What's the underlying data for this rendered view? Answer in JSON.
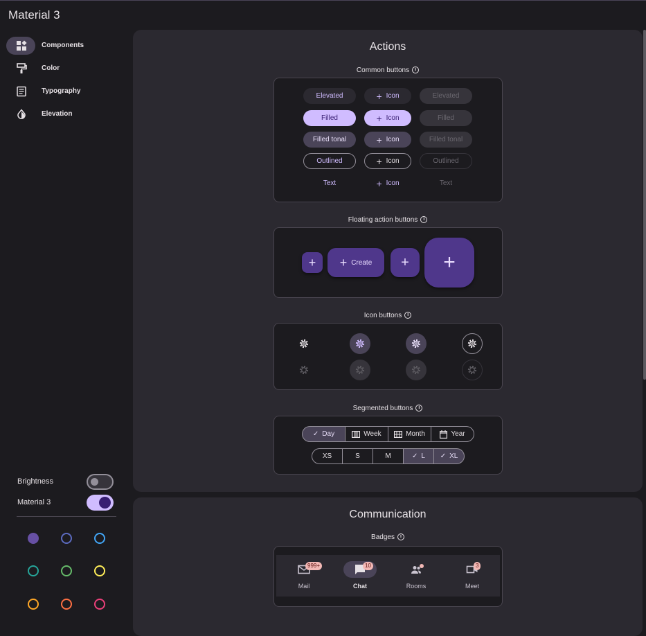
{
  "app": {
    "title": "Material 3"
  },
  "nav": {
    "items": [
      {
        "label": "Components",
        "icon": "widgets-icon",
        "active": true
      },
      {
        "label": "Color",
        "icon": "format-paint-icon"
      },
      {
        "label": "Typography",
        "icon": "article-icon"
      },
      {
        "label": "Elevation",
        "icon": "opacity-icon"
      }
    ]
  },
  "settings": {
    "brightness_label": "Brightness",
    "brightness_on": false,
    "material3_label": "Material 3",
    "material3_on": true,
    "color_choices": [
      "#6750a4",
      "#5c6bc0",
      "#42a5f5",
      "#26a69a",
      "#66bb6a",
      "#ffee58",
      "#ffa726",
      "#ff7043",
      "#ec407a"
    ]
  },
  "actions": {
    "title": "Actions",
    "common": {
      "title": "Common buttons",
      "rows": [
        {
          "enabled": "Elevated",
          "icon": "Icon",
          "disabled": "Elevated"
        },
        {
          "enabled": "Filled",
          "icon": "Icon",
          "disabled": "Filled"
        },
        {
          "enabled": "Filled tonal",
          "icon": "Icon",
          "disabled": "Filled tonal"
        },
        {
          "enabled": "Outlined",
          "icon": "Icon",
          "disabled": "Outlined"
        },
        {
          "enabled": "Text",
          "icon": "Icon",
          "disabled": "Text"
        }
      ]
    },
    "fab": {
      "title": "Floating action buttons",
      "extended_label": "Create"
    },
    "icon_buttons": {
      "title": "Icon buttons"
    },
    "segmented": {
      "title": "Segmented buttons",
      "row1": [
        "Day",
        "Week",
        "Month",
        "Year"
      ],
      "row2": [
        "XS",
        "S",
        "M",
        "L",
        "XL"
      ]
    }
  },
  "communication": {
    "title": "Communication",
    "badges": {
      "title": "Badges",
      "items": [
        {
          "label": "Mail",
          "badge": "999+"
        },
        {
          "label": "Chat",
          "badge": "10"
        },
        {
          "label": "Rooms",
          "badge": ""
        },
        {
          "label": "Meet",
          "badge": "3"
        }
      ]
    }
  },
  "colors": {
    "primary": "#d0bcff",
    "on_primary": "#381e72",
    "surface": "#1c1b1f",
    "surface_container": "#2b2930",
    "fab": "#4f378b",
    "badge": "#f2b8b5"
  }
}
